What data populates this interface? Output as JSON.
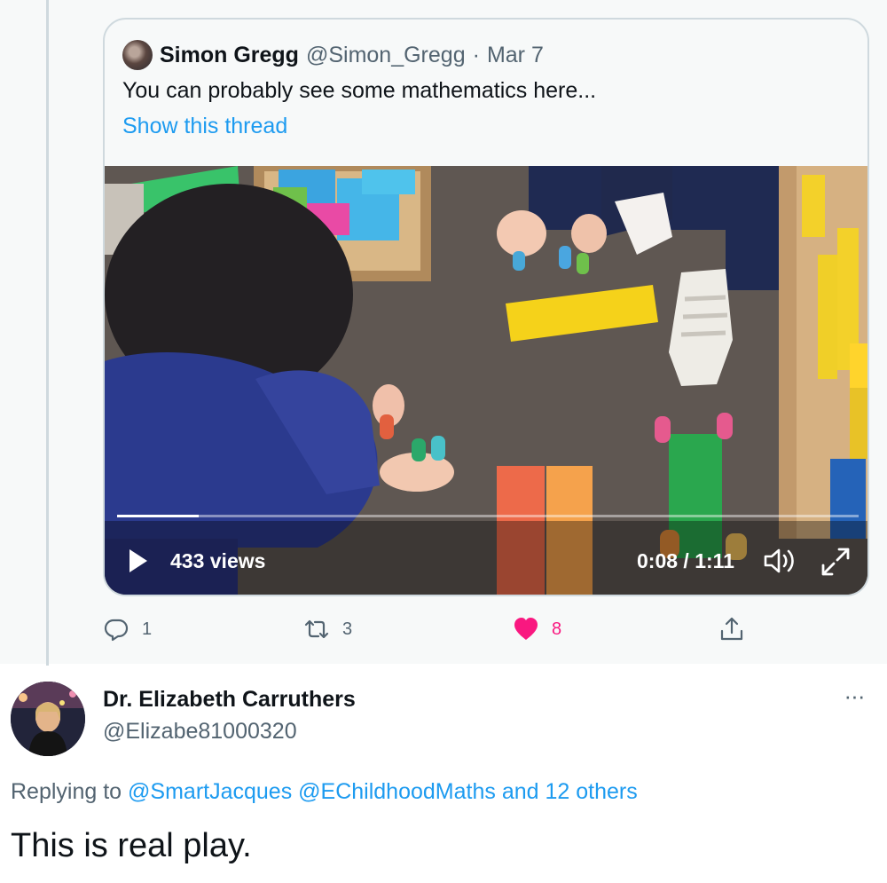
{
  "quoted_tweet": {
    "author_name": "Simon Gregg",
    "author_handle": "@Simon_Gregg",
    "separator": "·",
    "date": "Mar 7",
    "text": "You can probably see some mathematics here...",
    "show_thread_label": "Show this thread",
    "video": {
      "views": "433 views",
      "time": "0:08 / 1:11",
      "progress": 0.11
    }
  },
  "actions": {
    "reply_count": "1",
    "retweet_count": "3",
    "like_count": "8",
    "icons": [
      "reply-icon",
      "retweet-icon",
      "heart-icon",
      "share-icon"
    ]
  },
  "reply_tweet": {
    "author_name": "Dr. Elizabeth Carruthers",
    "author_handle": "@Elizabe81000320",
    "more_label": "···",
    "replying_prefix": "Replying to",
    "mention_1": "@SmartJacques",
    "mention_2": "@EChildhoodMaths",
    "mention_suffix": "and 12 others",
    "text": "This is real play."
  },
  "colors": {
    "accent": "#1d9bf0",
    "like": "#f91880",
    "muted": "#536471",
    "border": "#cfd9de"
  }
}
